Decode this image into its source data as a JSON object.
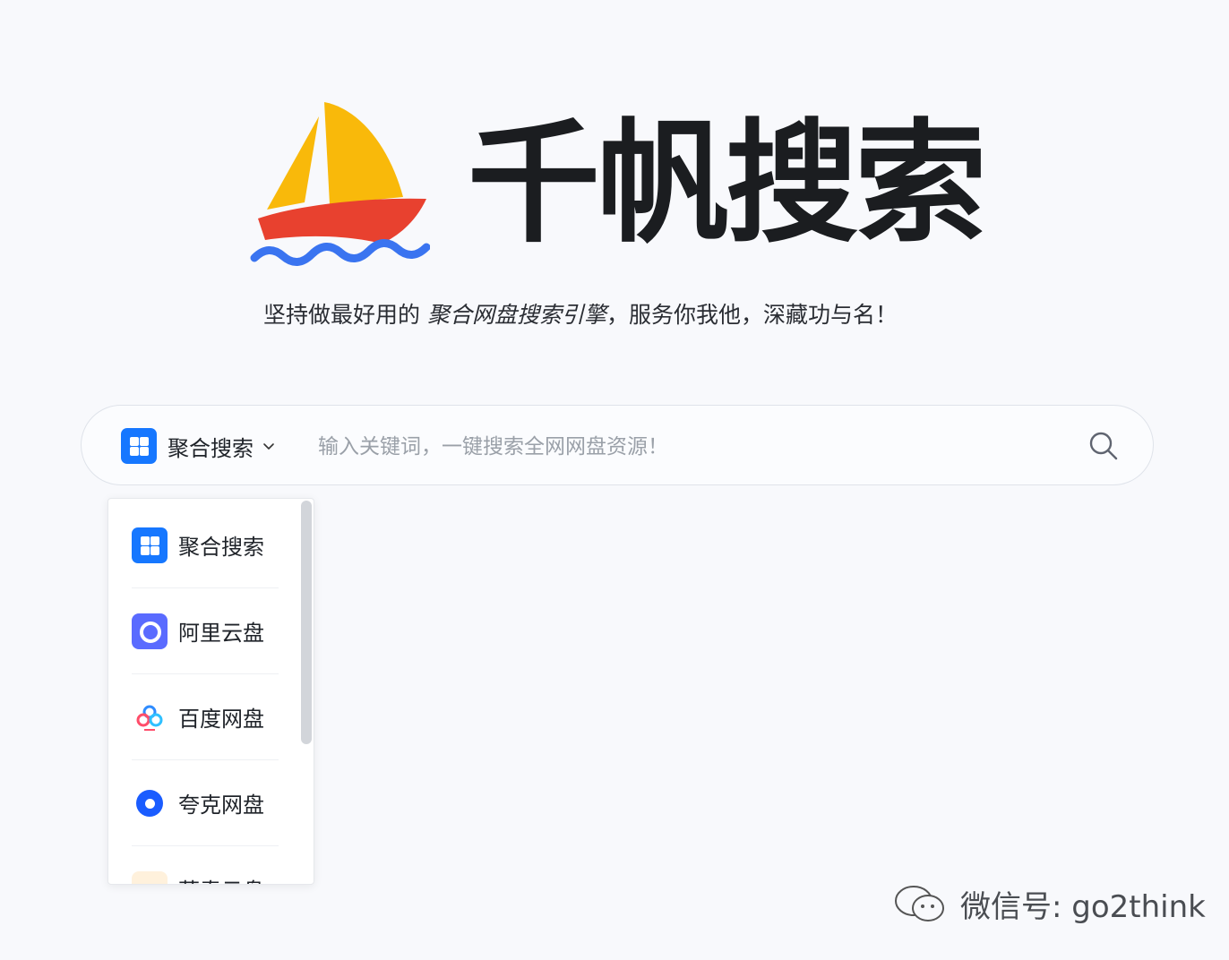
{
  "brand": {
    "title": "千帆搜索",
    "logo_icon": "sailboat-logo-icon"
  },
  "slogan": {
    "prefix": "坚持做最好用的 ",
    "emphasis": "聚合网盘搜索引擎",
    "suffix": "，服务你我他，深藏功与名！"
  },
  "search": {
    "engine_label": "聚合搜索",
    "engine_icon": "grid-icon",
    "dropdown_icon": "chevron-down-icon",
    "placeholder": "输入关键词，一键搜索全网网盘资源！",
    "value": "",
    "submit_icon": "search-icon"
  },
  "dropdown": {
    "items": [
      {
        "label": "聚合搜索",
        "icon": "grid-icon"
      },
      {
        "label": "阿里云盘",
        "icon": "aliyun-drive-icon"
      },
      {
        "label": "百度网盘",
        "icon": "baidu-netdisk-icon"
      },
      {
        "label": "夸克网盘",
        "icon": "quark-drive-icon"
      },
      {
        "label": "蓝奏云盘",
        "icon": "lanzou-cloud-icon"
      }
    ]
  },
  "watermark": {
    "text": "微信号: go2think",
    "icon": "wechat-icon"
  },
  "colors": {
    "accent": "#1677ff",
    "sail_yellow": "#f9b90a",
    "hull_red": "#e8412f",
    "wave_blue": "#3a74f0"
  }
}
